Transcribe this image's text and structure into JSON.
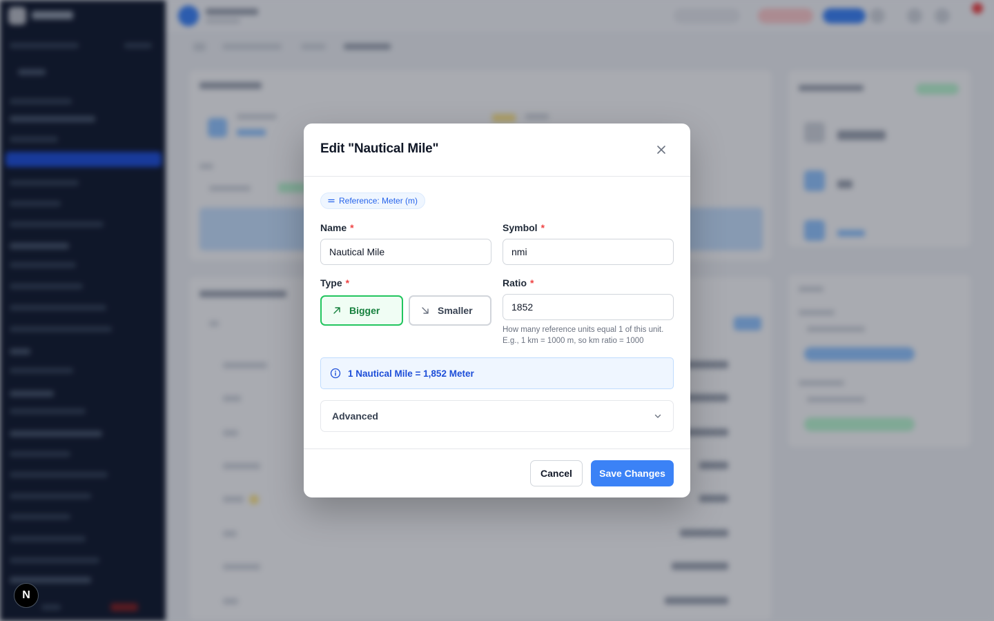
{
  "modal": {
    "title": "Edit \"Nautical Mile\"",
    "reference_label": "Reference: Meter (m)",
    "name_label": "Name",
    "name_value": "Nautical Mile",
    "symbol_label": "Symbol",
    "symbol_value": "nmi",
    "type_label": "Type",
    "type_options": [
      "Bigger",
      "Smaller"
    ],
    "type_selected": "Bigger",
    "ratio_label": "Ratio",
    "ratio_value": "1852",
    "ratio_help": "How many reference units equal 1 of this unit. E.g., 1 km = 1000 m, so km ratio = 1000",
    "required_marker": "*",
    "conversion_summary": "1 Nautical Mile = 1,852 Meter",
    "advanced_label": "Advanced",
    "cancel_label": "Cancel",
    "save_label": "Save Changes"
  },
  "badge": {
    "label": "N"
  },
  "colors": {
    "accent": "#3b82f6",
    "type_active": "#22c55e",
    "required": "#ef4444",
    "info": "#1d4ed8",
    "sidebar": "#0f172a"
  },
  "icons": {
    "close": "close-icon",
    "reference": "equals-icon",
    "bigger": "arrow-up-right-icon",
    "smaller": "arrow-down-right-icon",
    "info": "info-icon",
    "advanced": "chevron-down-icon"
  }
}
